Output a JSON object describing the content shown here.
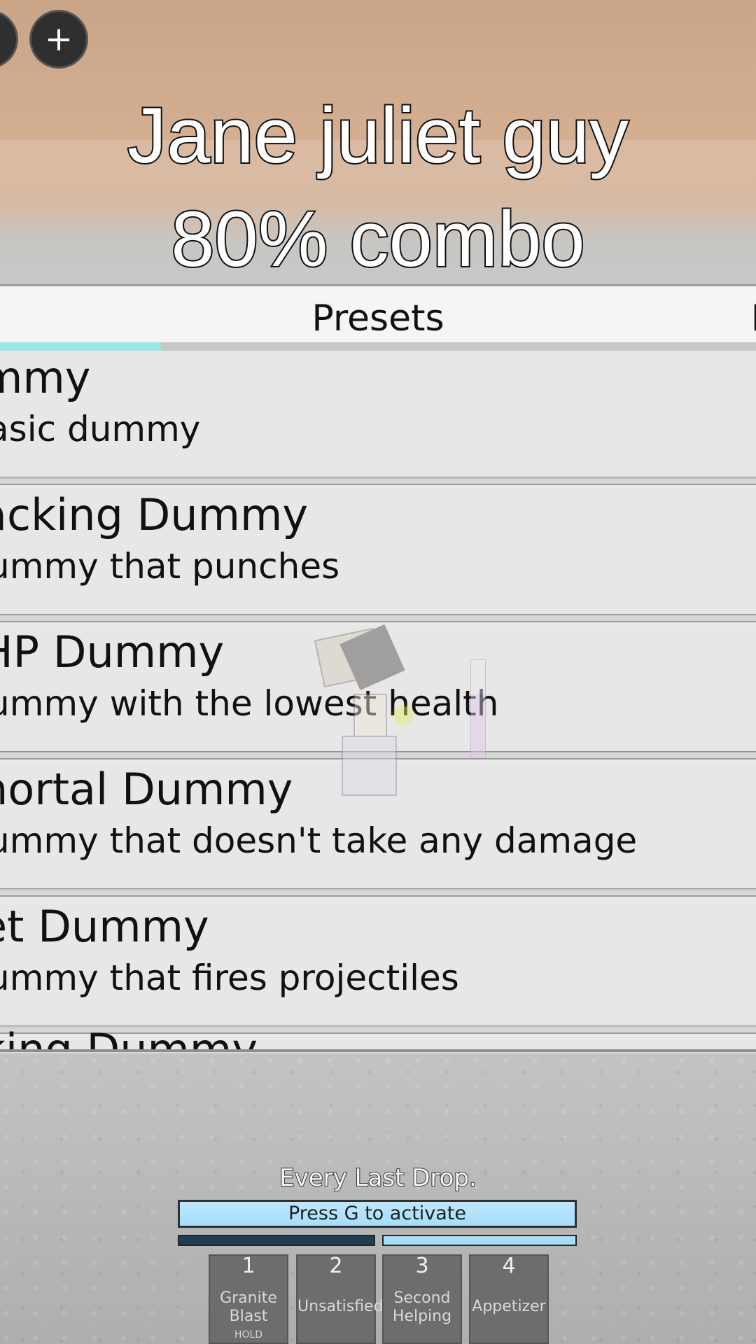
{
  "overlay": {
    "caption_line1": "Jane juliet guy",
    "caption_line2": "80% combo"
  },
  "top_controls": {
    "left_button_icon": "partial-button-icon",
    "plus_button_icon": "plus-icon",
    "plus_label": "+"
  },
  "panel": {
    "active_tab": "Presets",
    "right_tab_partial": "P",
    "items": [
      {
        "name": "mmy",
        "description": "asic dummy"
      },
      {
        "name": "acking Dummy",
        "description": "ummy that punches"
      },
      {
        "name": " HP Dummy",
        "description": "ummy with the lowest health"
      },
      {
        "name": "nortal Dummy",
        "description": "ummy that doesn't take any damage"
      },
      {
        "name": "et Dummy",
        "description": "ummy that fires projectiles"
      },
      {
        "name": "king Dummy",
        "description": ""
      }
    ]
  },
  "hud": {
    "title": "Every Last Drop.",
    "activate_text": "Press G to activate",
    "meter_left_fill": 1.0,
    "meter_right_fill": 1.0,
    "slots": [
      {
        "number": "1",
        "label": "Granite\nBlast",
        "hold": "HOLD"
      },
      {
        "number": "2",
        "label": "Unsatisfied",
        "hold": ""
      },
      {
        "number": "3",
        "label": "Second\nHelping",
        "hold": ""
      },
      {
        "number": "4",
        "label": "Appetizer",
        "hold": ""
      }
    ]
  },
  "colors": {
    "accent_tab": "#9ee6e6",
    "activate_bar": "#a6ddfa",
    "meter_dark": "#203d52"
  }
}
